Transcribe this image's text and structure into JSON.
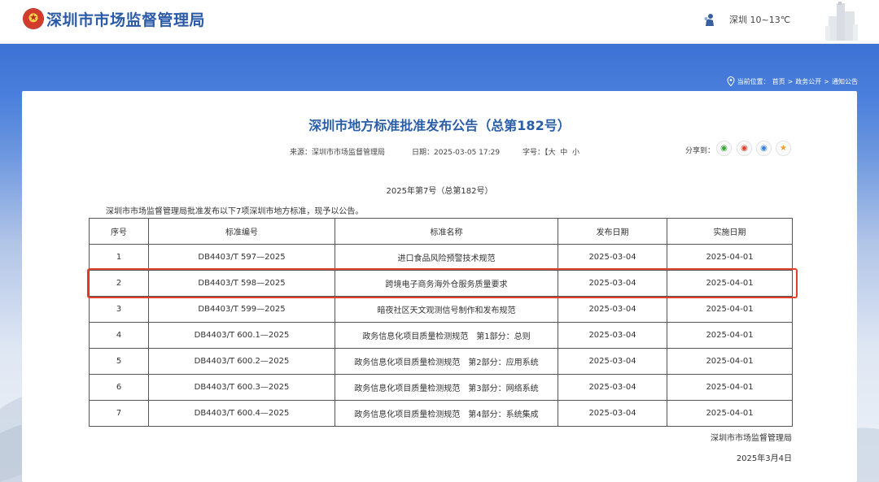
{
  "header": {
    "site_title": "深圳市市场监督管理局",
    "weather": "深圳 10~13℃"
  },
  "breadcrumb": {
    "prefix": "当前位置：",
    "items": [
      "首页",
      "政务公开",
      "通知公告"
    ],
    "separator": ">"
  },
  "article": {
    "title": "深圳市地方标准批准发布公告（总第182号）",
    "source_label": "来源：深圳市市场监督管理局",
    "date_label": "日期：2025-03-05 17:29",
    "fontsize": {
      "label": "字号：",
      "open_bracket": "【",
      "large": "大",
      "medium": "中",
      "small": "小"
    },
    "share_label": "分享到：",
    "share_icons": [
      "wechat-icon",
      "weibo-icon",
      "qq-icon",
      "qzone-icon"
    ],
    "issue_no": "2025年第7号（总第182号）",
    "intro": "深圳市市场监督管理局批准发布以下7项深圳市地方标准，现予以公告。",
    "signature": "深圳市市场监督管理局",
    "signature_date": "2025年3月4日"
  },
  "table": {
    "headers": [
      "序号",
      "标准编号",
      "标准名称",
      "发布日期",
      "实施日期"
    ],
    "rows": [
      [
        "1",
        "DB4403/T 597—2025",
        "进口食品风险预警技术规范",
        "2025-03-04",
        "2025-04-01"
      ],
      [
        "2",
        "DB4403/T 598—2025",
        "跨境电子商务海外仓服务质量要求",
        "2025-03-04",
        "2025-04-01"
      ],
      [
        "3",
        "DB4403/T 599—2025",
        "暗夜社区天文观测信号制作和发布规范",
        "2025-03-04",
        "2025-04-01"
      ],
      [
        "4",
        "DB4403/T 600.1—2025",
        "政务信息化项目质量检测规范　第1部分：总则",
        "2025-03-04",
        "2025-04-01"
      ],
      [
        "5",
        "DB4403/T 600.2—2025",
        "政务信息化项目质量检测规范　第2部分：应用系统",
        "2025-03-04",
        "2025-04-01"
      ],
      [
        "6",
        "DB4403/T 600.3—2025",
        "政务信息化项目质量检测规范　第3部分：网络系统",
        "2025-03-04",
        "2025-04-01"
      ],
      [
        "7",
        "DB4403/T 600.4—2025",
        "政务信息化项目质量检测规范　第4部分：系统集成",
        "2025-03-04",
        "2025-04-01"
      ]
    ]
  },
  "colors": {
    "brand_blue": "#2b5aa8",
    "title_blue": "#2a5ea8",
    "highlight_red": "#e2412b"
  }
}
